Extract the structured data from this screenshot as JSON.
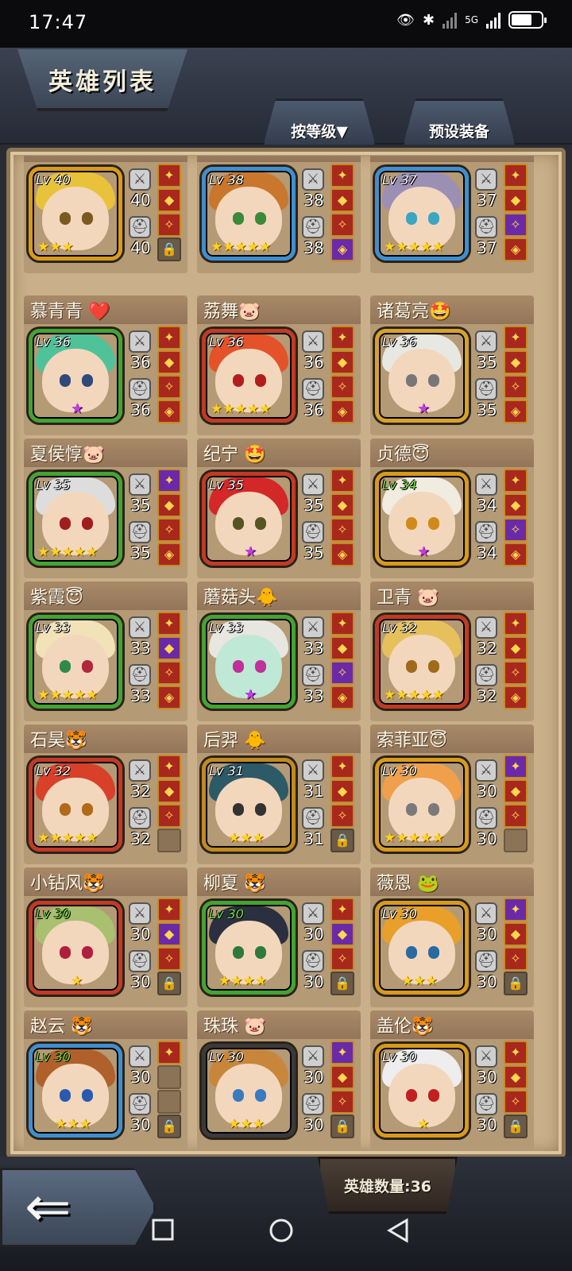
{
  "status_bar": {
    "time": "17:47",
    "network": "5G"
  },
  "header": {
    "title": "英雄列表",
    "sort_button": "按等级▼",
    "preset_button": "预设装备"
  },
  "footer": {
    "hero_count_label": "英雄数量:36"
  },
  "heroes": [
    {
      "name": "",
      "level": "Lv 40",
      "atk": "40",
      "def": "40",
      "stars": "★★★"
    },
    {
      "name": "",
      "level": "Lv 38",
      "atk": "38",
      "def": "38",
      "stars": "★★★★★"
    },
    {
      "name": "",
      "level": "Lv 37",
      "atk": "37",
      "def": "37",
      "stars": "★★★★★"
    },
    {
      "name": "慕青青 ❤️",
      "level": "Lv 36",
      "atk": "36",
      "def": "36",
      "stars": "★"
    },
    {
      "name": "荔舞🐷",
      "level": "Lv 36",
      "atk": "36",
      "def": "36",
      "stars": "★★★★★"
    },
    {
      "name": "诸葛亮🤩",
      "level": "Lv 36",
      "atk": "35",
      "def": "35",
      "stars": "★"
    },
    {
      "name": "夏侯惇🐷",
      "level": "Lv 35",
      "atk": "35",
      "def": "35",
      "stars": "★★★★★"
    },
    {
      "name": "纪宁 🤩",
      "level": "Lv 35",
      "atk": "35",
      "def": "35",
      "stars": "★"
    },
    {
      "name": "贞德😇",
      "level": "Lv 34",
      "atk": "34",
      "def": "34",
      "stars": "★"
    },
    {
      "name": "紫霞😇",
      "level": "Lv 33",
      "atk": "33",
      "def": "33",
      "stars": "★★★★★"
    },
    {
      "name": "蘑菇头🐥",
      "level": "Lv 33",
      "atk": "33",
      "def": "33",
      "stars": "★"
    },
    {
      "name": "卫青 🐷",
      "level": "Lv 32",
      "atk": "32",
      "def": "32",
      "stars": "★★★★★"
    },
    {
      "name": "石昊🐯",
      "level": "Lv 32",
      "atk": "32",
      "def": "32",
      "stars": "★★★★★"
    },
    {
      "name": "后羿 🐥",
      "level": "Lv 31",
      "atk": "31",
      "def": "31",
      "stars": "★★★"
    },
    {
      "name": "索菲亚😇",
      "level": "Lv 30",
      "atk": "30",
      "def": "30",
      "stars": "★★★★★"
    },
    {
      "name": "小钻风🐯",
      "level": "Lv 30",
      "atk": "30",
      "def": "30",
      "stars": "★"
    },
    {
      "name": "柳夏 🐯",
      "level": "Lv 30",
      "atk": "30",
      "def": "30",
      "stars": "★★★★"
    },
    {
      "name": "薇恩 🐸",
      "level": "Lv 30",
      "atk": "30",
      "def": "30",
      "stars": "★★★"
    },
    {
      "name": "赵云 🐯",
      "level": "Lv 30",
      "atk": "30",
      "def": "30",
      "stars": "★★★"
    },
    {
      "name": "珠珠 🐷",
      "level": "Lv 30",
      "atk": "30",
      "def": "30",
      "stars": "★★★"
    },
    {
      "name": "盖伦🐯",
      "level": "Lv 30",
      "atk": "30",
      "def": "30",
      "stars": "★"
    }
  ],
  "colors": {
    "panel": "#c9b08a",
    "name_bar": "#a88a68",
    "card_body": "#b49a75",
    "star": "#ffd21e"
  }
}
